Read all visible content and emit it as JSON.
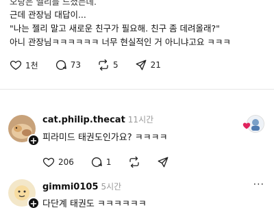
{
  "post": {
    "lines": [
      "오랑은 멜리를 드셨는데.",
      "근데 관장님 대답이...",
      "\"나는 젤리 말고 새로운 친구가 필요해. 친구 좀 데려올래?\"",
      "아니 관장님ㅋㅋㅋㅋㅋㅋ 너무 현실적인 거 아니냐고요 ㅋㅋㅋ"
    ],
    "likes": "1천",
    "comments": "73",
    "reposts": "5",
    "shares": "21"
  },
  "comments": [
    {
      "username": "cat.philip.thecat",
      "time": "11시간",
      "text": "피라미드 태권도인가요? ㅋㅋㅋㅋ",
      "likes": "206",
      "comments": "1",
      "more": "···"
    },
    {
      "username": "gimmi0105",
      "time": "5시간",
      "text": "다단계 태권도 ㅋㅋㅋㅋㅋㅋ",
      "more": "···"
    }
  ],
  "colors": {
    "heart_red": "#e0245e",
    "muted": "#999999"
  },
  "icons": [
    "heart-icon",
    "comment-icon",
    "repost-icon",
    "share-icon",
    "plus-icon",
    "more-icon"
  ]
}
